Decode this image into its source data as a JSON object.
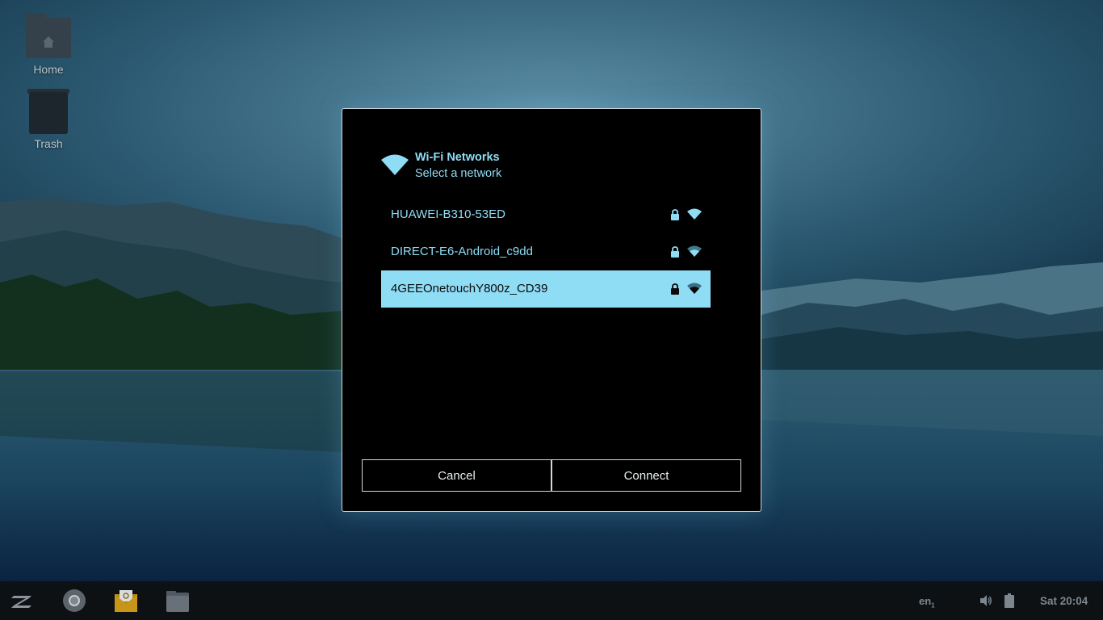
{
  "desktop": {
    "icons": [
      {
        "label": "Home",
        "icon": "home-folder-icon"
      },
      {
        "label": "Trash",
        "icon": "trash-icon"
      }
    ]
  },
  "dialog": {
    "title": "Wi-Fi Networks",
    "subtitle": "Select a network",
    "icon": "wifi-icon",
    "networks": [
      {
        "ssid": "HUAWEI-B310-53ED",
        "secured": true,
        "selected": false
      },
      {
        "ssid": "DIRECT-E6-Android_c9dd",
        "secured": true,
        "selected": false
      },
      {
        "ssid": "4GEEOnetouchY800z_CD39",
        "secured": true,
        "selected": true
      }
    ],
    "cancel_label": "Cancel",
    "connect_label": "Connect"
  },
  "taskbar": {
    "apps": [
      "zorin-menu-icon",
      "chrome-icon",
      "mail-icon",
      "files-icon"
    ],
    "language": "en",
    "language_sub": "1",
    "time": "Sat 20:04"
  },
  "colors": {
    "accent": "#8fdcf5",
    "dialog_bg": "#000000",
    "taskbar_bg": "#0d1114"
  }
}
